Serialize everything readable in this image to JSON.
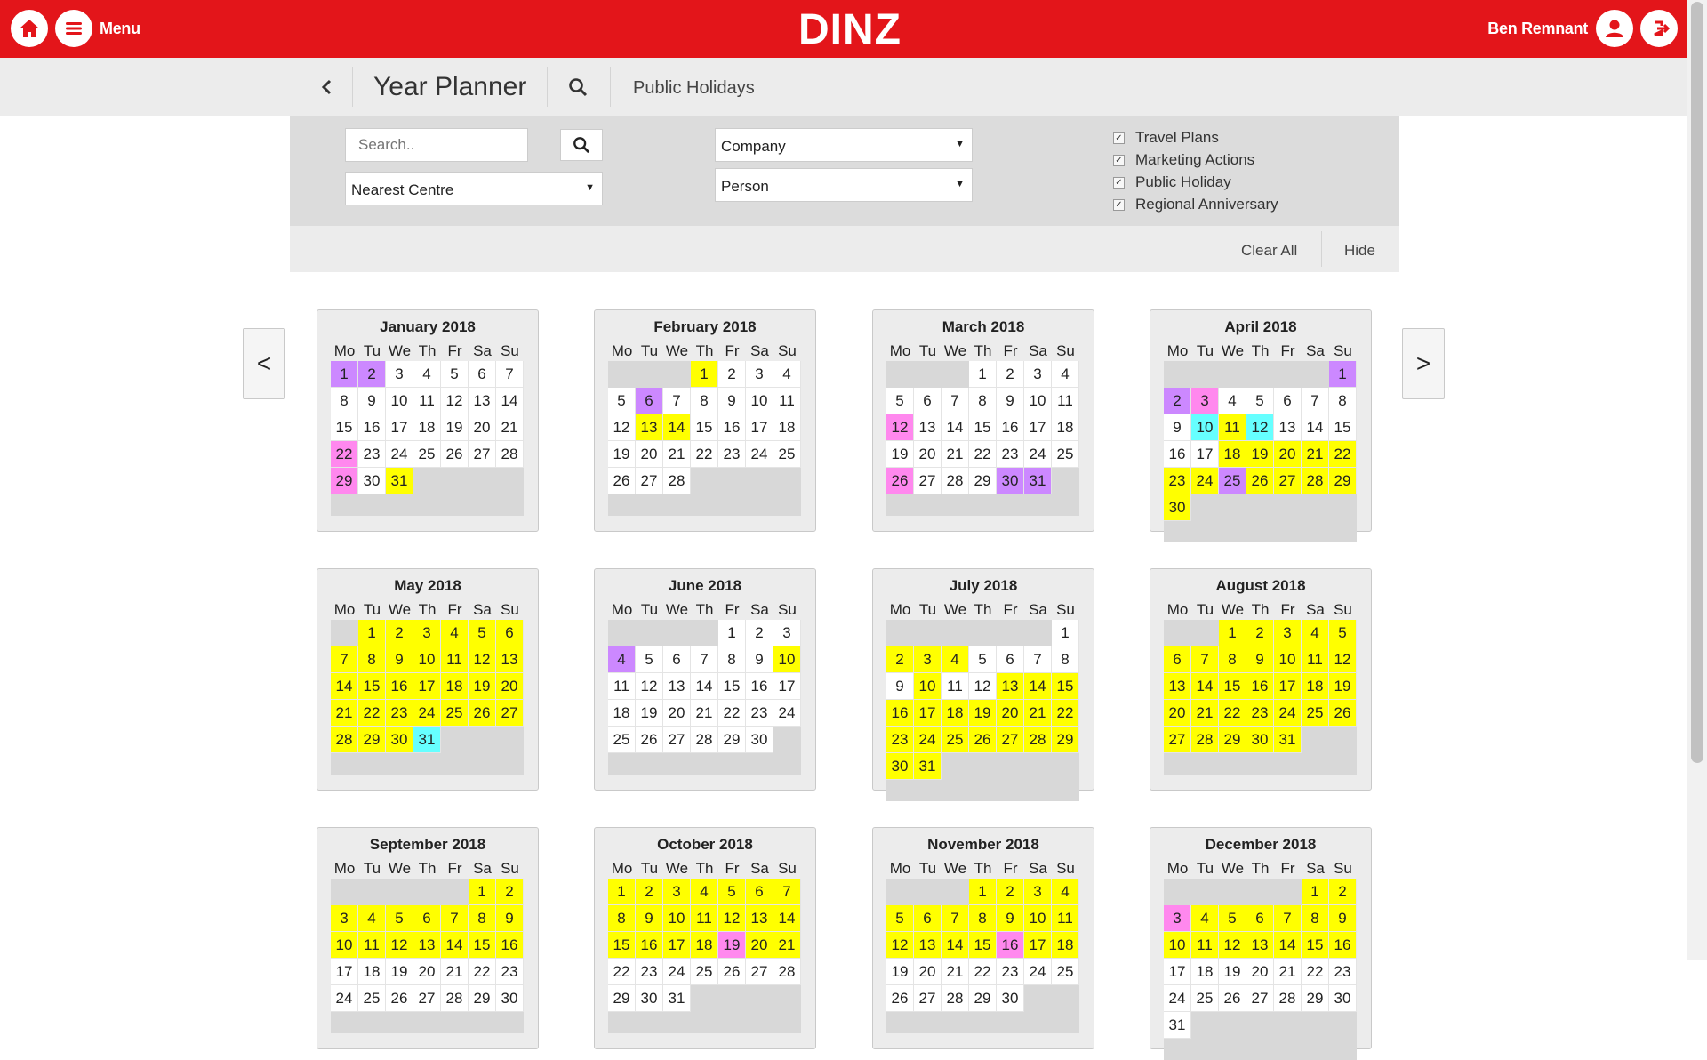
{
  "app": {
    "brand": "DINZ",
    "menu_label": "Menu",
    "user_name": "Ben Remnant"
  },
  "subheader": {
    "title": "Year Planner",
    "filter_label": "Public Holidays"
  },
  "filters": {
    "search_placeholder": "Search..",
    "nearest_centre": "Nearest Centre",
    "company": "Company",
    "person": "Person",
    "checkboxes": [
      {
        "label": "Travel Plans",
        "checked": true
      },
      {
        "label": "Marketing Actions",
        "checked": true
      },
      {
        "label": "Public Holiday",
        "checked": true
      },
      {
        "label": "Regional Anniversary",
        "checked": true
      }
    ],
    "clear_all": "Clear All",
    "hide": "Hide"
  },
  "nav": {
    "prev": "<",
    "next": ">"
  },
  "colors": {
    "topbar": "#e3151a",
    "yellow": "#ffff00",
    "purple": "#cc88ff",
    "pink": "#ff88ee",
    "cyan": "#66ffff"
  },
  "weekday_labels": [
    "Mo",
    "Tu",
    "We",
    "Th",
    "Fr",
    "Sa",
    "Su"
  ],
  "months": [
    {
      "name": "January 2018",
      "offset": 0,
      "days": 31,
      "highlights": {
        "1": "purple",
        "2": "purple",
        "22": "pink",
        "29": "pink",
        "31": "yellow"
      }
    },
    {
      "name": "February 2018",
      "offset": 3,
      "days": 28,
      "highlights": {
        "1": "yellow",
        "6": "purple",
        "13": "yellow",
        "14": "yellow"
      }
    },
    {
      "name": "March 2018",
      "offset": 3,
      "days": 31,
      "highlights": {
        "12": "pink",
        "26": "pink",
        "30": "purple",
        "31": "purple"
      }
    },
    {
      "name": "April 2018",
      "offset": 6,
      "days": 30,
      "highlights": {
        "1": "purple",
        "2": "purple",
        "3": "pink",
        "10": "cyan",
        "11": "yellow",
        "12": "cyan",
        "18": "yellow",
        "19": "yellow",
        "20": "yellow",
        "21": "yellow",
        "22": "yellow",
        "23": "yellow",
        "24": "yellow",
        "25": "purple",
        "26": "yellow",
        "27": "yellow",
        "28": "yellow",
        "29": "yellow",
        "30": "yellow"
      }
    },
    {
      "name": "May 2018",
      "offset": 1,
      "days": 31,
      "highlights": {
        "1": "yellow",
        "2": "yellow",
        "3": "yellow",
        "4": "yellow",
        "5": "yellow",
        "6": "yellow",
        "7": "yellow",
        "8": "yellow",
        "9": "yellow",
        "10": "yellow",
        "11": "yellow",
        "12": "yellow",
        "13": "yellow",
        "14": "yellow",
        "15": "yellow",
        "16": "yellow",
        "17": "yellow",
        "18": "yellow",
        "19": "yellow",
        "20": "yellow",
        "21": "yellow",
        "22": "yellow",
        "23": "yellow",
        "24": "yellow",
        "25": "yellow",
        "26": "yellow",
        "27": "yellow",
        "28": "yellow",
        "29": "yellow",
        "30": "yellow",
        "31": "cyan"
      }
    },
    {
      "name": "June 2018",
      "offset": 4,
      "days": 30,
      "highlights": {
        "4": "purple",
        "10": "yellow"
      }
    },
    {
      "name": "July 2018",
      "offset": 6,
      "days": 31,
      "highlights": {
        "2": "yellow",
        "3": "yellow",
        "4": "yellow",
        "10": "yellow",
        "13": "yellow",
        "14": "yellow",
        "15": "yellow",
        "16": "yellow",
        "17": "yellow",
        "18": "yellow",
        "19": "yellow",
        "20": "yellow",
        "21": "yellow",
        "22": "yellow",
        "23": "yellow",
        "24": "yellow",
        "25": "yellow",
        "26": "yellow",
        "27": "yellow",
        "28": "yellow",
        "29": "yellow",
        "30": "yellow",
        "31": "yellow"
      }
    },
    {
      "name": "August 2018",
      "offset": 2,
      "days": 31,
      "highlights": {
        "1": "yellow",
        "2": "yellow",
        "3": "yellow",
        "4": "yellow",
        "5": "yellow",
        "6": "yellow",
        "7": "yellow",
        "8": "yellow",
        "9": "yellow",
        "10": "yellow",
        "11": "yellow",
        "12": "yellow",
        "13": "yellow",
        "14": "yellow",
        "15": "yellow",
        "16": "yellow",
        "17": "yellow",
        "18": "yellow",
        "19": "yellow",
        "20": "yellow",
        "21": "yellow",
        "22": "yellow",
        "23": "yellow",
        "24": "yellow",
        "25": "yellow",
        "26": "yellow",
        "27": "yellow",
        "28": "yellow",
        "29": "yellow",
        "30": "yellow",
        "31": "yellow"
      }
    },
    {
      "name": "September 2018",
      "offset": 5,
      "days": 30,
      "highlights": {
        "1": "yellow",
        "2": "yellow",
        "3": "yellow",
        "4": "yellow",
        "5": "yellow",
        "6": "yellow",
        "7": "yellow",
        "8": "yellow",
        "9": "yellow",
        "10": "yellow",
        "11": "yellow",
        "12": "yellow",
        "13": "yellow",
        "14": "yellow",
        "15": "yellow",
        "16": "yellow"
      }
    },
    {
      "name": "October 2018",
      "offset": 0,
      "days": 31,
      "highlights": {
        "1": "yellow",
        "2": "yellow",
        "3": "yellow",
        "4": "yellow",
        "5": "yellow",
        "6": "yellow",
        "7": "yellow",
        "8": "yellow",
        "9": "yellow",
        "10": "yellow",
        "11": "yellow",
        "12": "yellow",
        "13": "yellow",
        "14": "yellow",
        "15": "yellow",
        "16": "yellow",
        "17": "yellow",
        "18": "yellow",
        "19": "pink",
        "20": "yellow",
        "21": "yellow"
      }
    },
    {
      "name": "November 2018",
      "offset": 3,
      "days": 30,
      "highlights": {
        "1": "yellow",
        "2": "yellow",
        "3": "yellow",
        "4": "yellow",
        "5": "yellow",
        "6": "yellow",
        "7": "yellow",
        "8": "yellow",
        "9": "yellow",
        "10": "yellow",
        "11": "yellow",
        "12": "yellow",
        "13": "yellow",
        "14": "yellow",
        "15": "yellow",
        "16": "pink",
        "17": "yellow",
        "18": "yellow"
      }
    },
    {
      "name": "December 2018",
      "offset": 5,
      "days": 31,
      "highlights": {
        "1": "yellow",
        "2": "yellow",
        "3": "pink",
        "4": "yellow",
        "5": "yellow",
        "6": "yellow",
        "7": "yellow",
        "8": "yellow",
        "9": "yellow",
        "10": "yellow",
        "11": "yellow",
        "12": "yellow",
        "13": "yellow",
        "14": "yellow",
        "15": "yellow",
        "16": "yellow"
      }
    }
  ]
}
